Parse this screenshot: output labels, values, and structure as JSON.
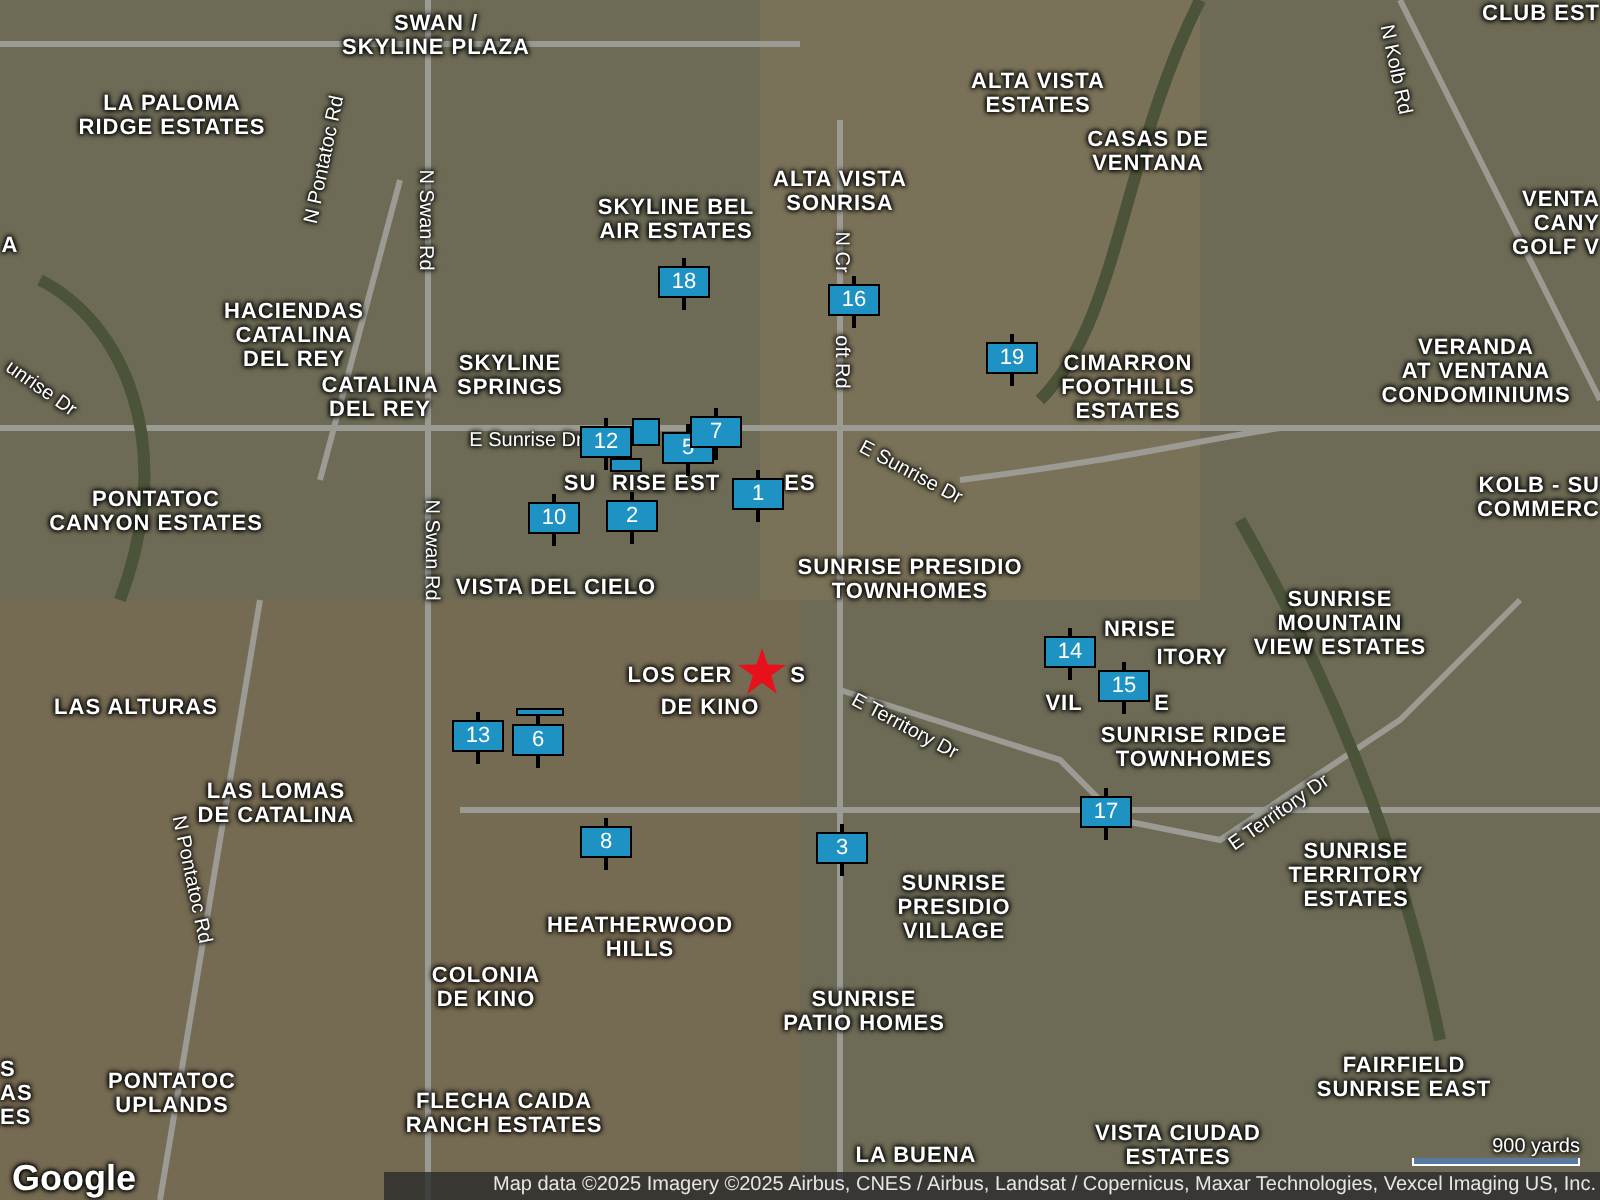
{
  "map": {
    "places": [
      {
        "lines": [
          "SWAN /",
          "SKYLINE PLAZA"
        ]
      },
      {
        "lines": [
          "CLUB EST"
        ]
      },
      {
        "lines": [
          "LA PALOMA",
          "RIDGE ESTATES"
        ]
      },
      {
        "lines": [
          "ALTA VISTA",
          "ESTATES"
        ]
      },
      {
        "lines": [
          "A"
        ]
      },
      {
        "lines": [
          "SKYLINE BEL",
          "AIR ESTATES"
        ]
      },
      {
        "lines": [
          "ALTA VISTA",
          "SONRISA"
        ]
      },
      {
        "lines": [
          "CASAS DE",
          "VENTANA"
        ]
      },
      {
        "lines": [
          "VENTA",
          "CANY",
          "GOLF V"
        ]
      },
      {
        "lines": [
          "HACIENDAS",
          "CATALINA",
          "DEL REY"
        ]
      },
      {
        "lines": [
          "CATALINA",
          "DEL REY"
        ]
      },
      {
        "lines": [
          "SKYLINE",
          "SPRINGS"
        ]
      },
      {
        "lines": [
          "CIMARRON",
          "FOOTHILLS",
          "ESTATES"
        ]
      },
      {
        "lines": [
          "VERANDA",
          "AT VENTANA",
          "CONDOMINIUMS"
        ]
      },
      {
        "lines": [
          "PONTATOC",
          "CANYON ESTATES"
        ]
      },
      {
        "lines": [
          "SU"
        ]
      },
      {
        "lines": [
          "RISE EST"
        ]
      },
      {
        "lines": [
          "ES"
        ]
      },
      {
        "lines": [
          "KOLB - SU",
          "COMMERC"
        ]
      },
      {
        "lines": [
          "VISTA DEL CIELO"
        ]
      },
      {
        "lines": [
          "SUNRISE PRESIDIO",
          "TOWNHOMES"
        ]
      },
      {
        "lines": [
          "NRISE"
        ]
      },
      {
        "lines": [
          "LOS CER"
        ]
      },
      {
        "lines": [
          "S"
        ]
      },
      {
        "lines": [
          "ITORY"
        ]
      },
      {
        "lines": [
          "SUNRISE",
          "MOUNTAIN",
          "VIEW ESTATES"
        ]
      },
      {
        "lines": [
          "LAS ALTURAS"
        ]
      },
      {
        "lines": [
          "DE KINO"
        ]
      },
      {
        "lines": [
          "VIL"
        ]
      },
      {
        "lines": [
          "E"
        ]
      },
      {
        "lines": [
          "SUNRISE RIDGE",
          "TOWNHOMES"
        ]
      },
      {
        "lines": [
          "LAS LOMAS",
          "DE CATALINA"
        ]
      },
      {
        "lines": [
          "HEATHERWOOD",
          "HILLS"
        ]
      },
      {
        "lines": [
          "SUNRISE",
          "PRESIDIO",
          "VILLAGE"
        ]
      },
      {
        "lines": [
          "SUNRISE",
          "TERRITORY",
          "ESTATES"
        ]
      },
      {
        "lines": [
          "COLONIA",
          "DE KINO"
        ]
      },
      {
        "lines": [
          "SUNRISE",
          "PATIO HOMES"
        ]
      },
      {
        "lines": [
          "S",
          "AS",
          "ES"
        ]
      },
      {
        "lines": [
          "PONTATOC",
          "UPLANDS"
        ]
      },
      {
        "lines": [
          "FLECHA CAIDA",
          "RANCH ESTATES"
        ]
      },
      {
        "lines": [
          "FAIRFIELD",
          "SUNRISE EAST"
        ]
      },
      {
        "lines": [
          "LA BUENA"
        ]
      },
      {
        "lines": [
          "VISTA CIUDAD",
          "ESTATES"
        ]
      }
    ],
    "roads": [
      {
        "name": "N Kolb Rd"
      },
      {
        "name": "N Pontatoc Rd"
      },
      {
        "name": "N Swan Rd"
      },
      {
        "name": "N Cr"
      },
      {
        "name": "oft Rd"
      },
      {
        "name": "unrise Dr"
      },
      {
        "name": "E Sunrise Dr"
      },
      {
        "name": "E Sunrise Dr"
      },
      {
        "name": "N Swan Rd"
      },
      {
        "name": "E Territory Dr"
      },
      {
        "name": "E Territory Dr"
      },
      {
        "name": "N Pontatoc Rd"
      }
    ],
    "markers": [
      {
        "kind": "numbered",
        "number": "18"
      },
      {
        "kind": "numbered",
        "number": "16"
      },
      {
        "kind": "numbered",
        "number": "19"
      },
      {
        "kind": "covered"
      },
      {
        "kind": "numbered",
        "number": "12"
      },
      {
        "kind": "numbered",
        "number": "5"
      },
      {
        "kind": "numbered",
        "number": "7"
      },
      {
        "kind": "covered"
      },
      {
        "kind": "numbered",
        "number": "1"
      },
      {
        "kind": "numbered",
        "number": "2"
      },
      {
        "kind": "numbered",
        "number": "10"
      },
      {
        "kind": "numbered",
        "number": "14"
      },
      {
        "kind": "numbered",
        "number": "15"
      },
      {
        "kind": "covered"
      },
      {
        "kind": "numbered",
        "number": "13"
      },
      {
        "kind": "numbered",
        "number": "6"
      },
      {
        "kind": "numbered",
        "number": "17"
      },
      {
        "kind": "numbered",
        "number": "8"
      },
      {
        "kind": "numbered",
        "number": "3"
      }
    ],
    "scale": "900 yards",
    "attribution": "Map data ©2025 Imagery ©2025 Airbus, CNES / Airbus, Landsat / Copernicus, Maxar Technologies, Vexcel Imaging US, Inc.",
    "logo": "Google"
  }
}
